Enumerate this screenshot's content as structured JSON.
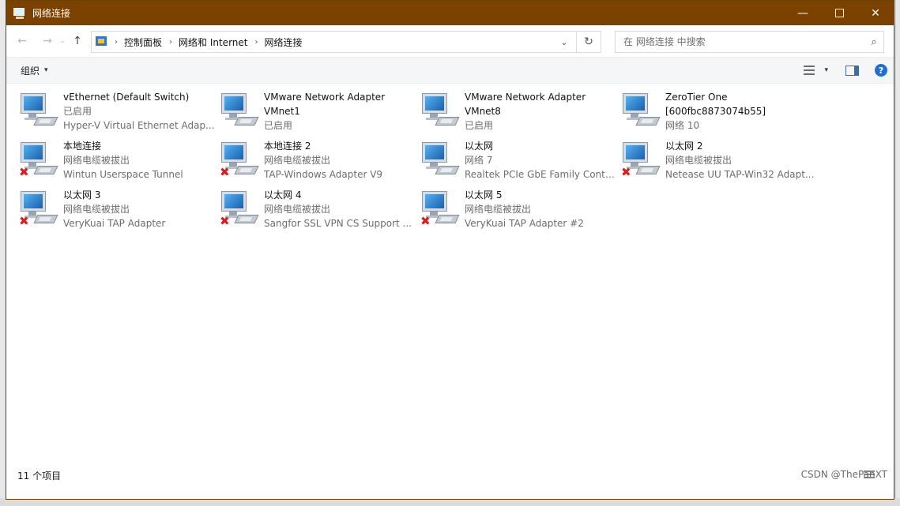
{
  "window": {
    "title": "网络连接",
    "minimize_symbol": "—",
    "close_symbol": "✕"
  },
  "nav": {
    "back_symbol": "←",
    "forward_symbol": "→",
    "recent_symbol": "⌄",
    "up_symbol": "↑",
    "breadcrumb": [
      "控制面板",
      "网络和 Internet",
      "网络连接"
    ],
    "breadcrumb_sep": "›",
    "dropdown_symbol": "⌄",
    "refresh_symbol": "↻"
  },
  "search": {
    "placeholder": "在 网络连接 中搜索",
    "icon": "search-icon"
  },
  "toolbar": {
    "organize_label": "组织",
    "chevron": "▾",
    "help_label": "?"
  },
  "adapters": [
    {
      "name": "vEthernet (Default Switch)",
      "name2": "",
      "status": "已启用",
      "device": "Hyper-V Virtual Ethernet Adap...",
      "disconnected": false
    },
    {
      "name": "VMware Network Adapter",
      "name2": "VMnet1",
      "status": "已启用",
      "device": "",
      "disconnected": false
    },
    {
      "name": "VMware Network Adapter",
      "name2": "VMnet8",
      "status": "已启用",
      "device": "",
      "disconnected": false
    },
    {
      "name": "ZeroTier One",
      "name2": "[600fbc8873074b55]",
      "status": "网络 10",
      "device": "",
      "disconnected": false
    },
    {
      "name": "本地连接",
      "name2": "",
      "status": "网络电缆被拔出",
      "device": "Wintun Userspace Tunnel",
      "disconnected": true
    },
    {
      "name": "本地连接 2",
      "name2": "",
      "status": "网络电缆被拔出",
      "device": "TAP-Windows Adapter V9",
      "disconnected": true
    },
    {
      "name": "以太网",
      "name2": "",
      "status": "网络 7",
      "device": "Realtek PCIe GbE Family Contr...",
      "disconnected": false
    },
    {
      "name": "以太网 2",
      "name2": "",
      "status": "网络电缆被拔出",
      "device": "Netease UU TAP-Win32 Adapt...",
      "disconnected": true
    },
    {
      "name": "以太网 3",
      "name2": "",
      "status": "网络电缆被拔出",
      "device": "VeryKuai TAP Adapter",
      "disconnected": true
    },
    {
      "name": "以太网 4",
      "name2": "",
      "status": "网络电缆被拔出",
      "device": "Sangfor SSL VPN CS Support ...",
      "disconnected": true
    },
    {
      "name": "以太网 5",
      "name2": "",
      "status": "网络电缆被拔出",
      "device": "VeryKuai TAP Adapter #2",
      "disconnected": true
    }
  ],
  "status_bar": {
    "count": "11 个项目"
  },
  "watermark": "CSDN @ThePanXT"
}
